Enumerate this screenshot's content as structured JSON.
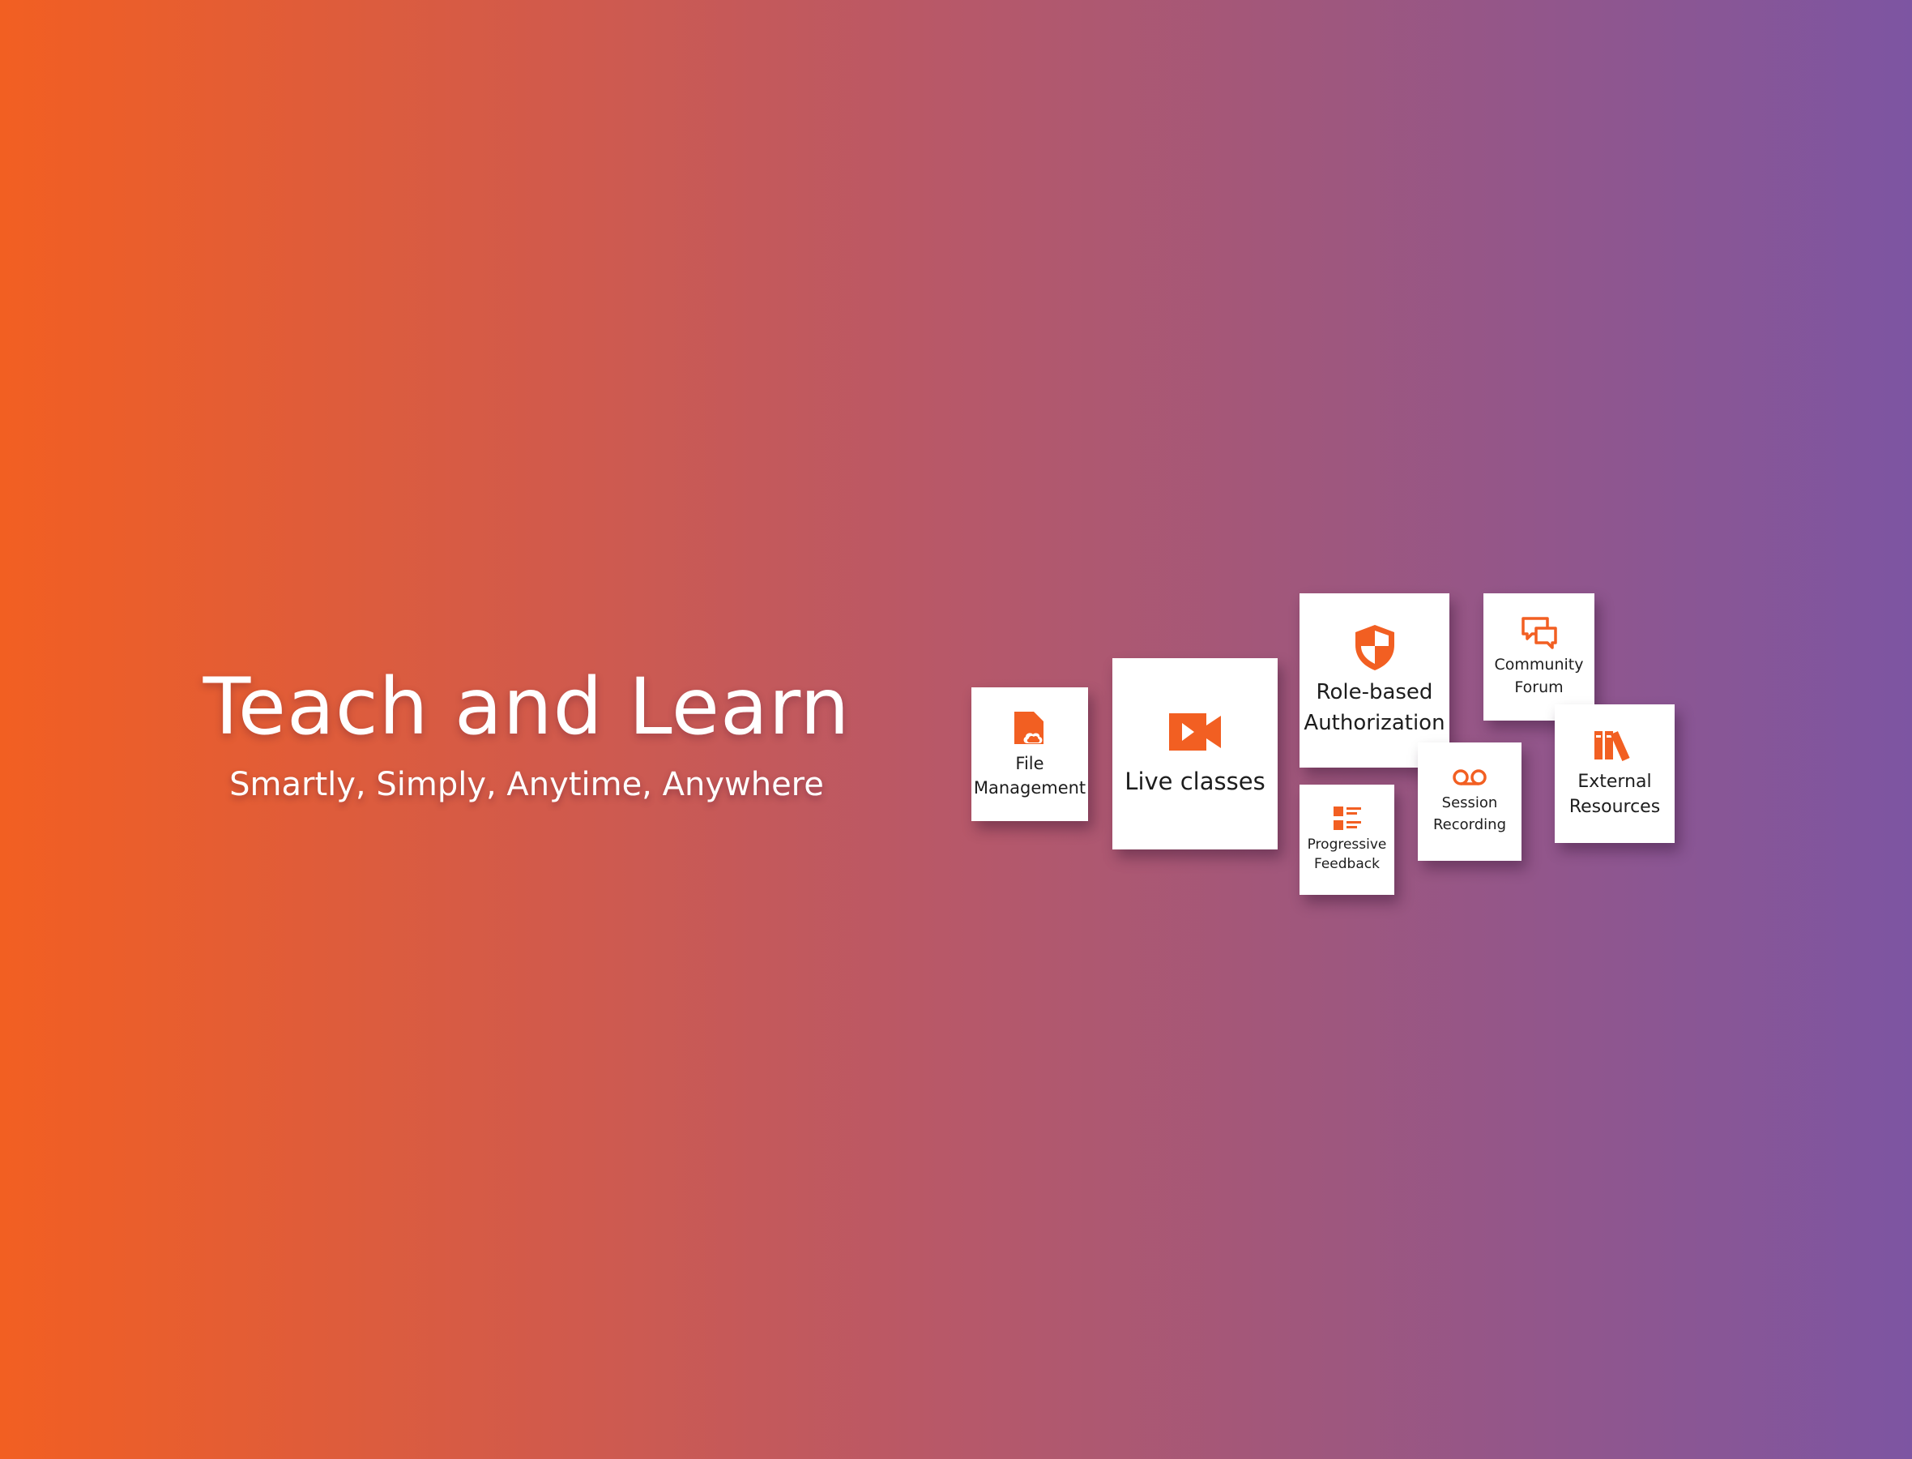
{
  "hero": {
    "title": "Teach and Learn",
    "subtitle": "Smartly, Simply, Anytime, Anywhere"
  },
  "colors": {
    "gradient_start": "#f25f22",
    "gradient_end": "#7d55a2",
    "accent": "#f25f22",
    "card_background": "#ffffff",
    "text": "#1d1d1d"
  },
  "features": {
    "file_management": {
      "label": "File\nManagement",
      "icon": "cloud-file-icon"
    },
    "live_classes": {
      "label": "Live classes",
      "icon": "video-camera-icon"
    },
    "role_based_authorization": {
      "label": "Role-based\nAuthorization",
      "icon": "shield-icon"
    },
    "progressive_feedback": {
      "label": "Progressive\nFeedback",
      "icon": "checklist-icon"
    },
    "session_recording": {
      "label": "Session\nRecording",
      "icon": "voicemail-icon"
    },
    "community_forum": {
      "label": "Community\nForum",
      "icon": "chat-bubbles-icon"
    },
    "external_resources": {
      "label": "External\nResources",
      "icon": "books-icon"
    }
  }
}
